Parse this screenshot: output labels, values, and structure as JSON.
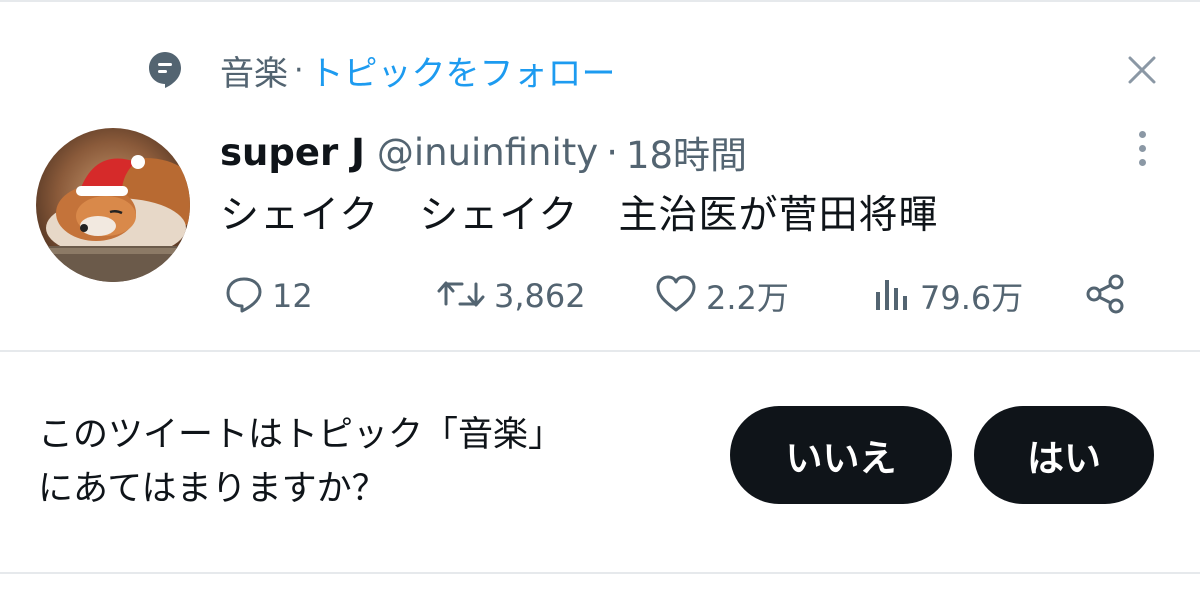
{
  "topic": {
    "name": "音楽",
    "separator": "·",
    "follow_label": "トピックをフォロー",
    "icon": "topic-speech-bubble-icon"
  },
  "tweet": {
    "display_name": "super J",
    "handle": "@inuinfinity",
    "separator": "·",
    "time": "18時間",
    "text": "シェイク　シェイク　主治医が菅田将暉",
    "avatar": "fox-santa-hat-avatar"
  },
  "actions": {
    "reply_count": "12",
    "retweet_count": "3,862",
    "like_count": "2.2万",
    "views_count": "79.6万"
  },
  "prompt": {
    "line1": "このツイートはトピック「音楽」",
    "line2": "にあてはまりますか？",
    "no_label": "いいえ",
    "yes_label": "はい"
  },
  "colors": {
    "link": "#1d9bf0",
    "muted": "#536471",
    "text": "#0f1419",
    "button_bg": "#0f1419",
    "border": "#e6e9ec"
  }
}
